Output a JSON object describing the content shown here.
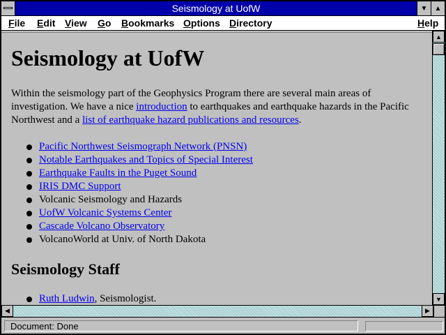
{
  "window": {
    "title": "Seismology at UofW",
    "minimize_icon": "down-triangle",
    "maximize_icon": "up-triangle"
  },
  "menu": {
    "file": "File",
    "edit": "Edit",
    "view": "View",
    "go": "Go",
    "bookmarks": "Bookmarks",
    "options": "Options",
    "directory": "Directory",
    "help": "Help"
  },
  "page": {
    "heading": "Seismology at UofW",
    "intro_1": "Within the seismology part of the Geophysics Program there are several main areas of investigation. We have a nice ",
    "intro_link_1": "introduction",
    "intro_2": " to earthquakes and earthquake hazards in the Pacific Northwest and a ",
    "intro_link_2": "list of earthquake hazard publications and resources",
    "intro_3": ".",
    "items": [
      {
        "text": "Pacific Northwest Seismograph Network (PNSN)",
        "link": true
      },
      {
        "text": "Notable Earthquakes and Topics of Special Interest",
        "link": true
      },
      {
        "text": "Earthquake Faults in the Puget Sound",
        "link": true
      },
      {
        "text": "IRIS DMC Support",
        "link": true
      },
      {
        "text": "Volcanic Seismology and Hazards",
        "link": false
      },
      {
        "text": "UofW Volcanic Systems Center",
        "link": true
      },
      {
        "text": "Cascade Volcano Observatory",
        "link": true
      },
      {
        "text": "VolcanoWorld at Univ. of North Dakota",
        "link": false
      }
    ],
    "staff_heading": "Seismology Staff",
    "staff": [
      {
        "name": "Ruth Ludwin",
        "role": ", Seismologist."
      }
    ]
  },
  "status": {
    "text": "Document: Done"
  },
  "colors": {
    "titlebar": "#0000aa",
    "link": "#0000ee",
    "background": "#c0c0c0"
  }
}
